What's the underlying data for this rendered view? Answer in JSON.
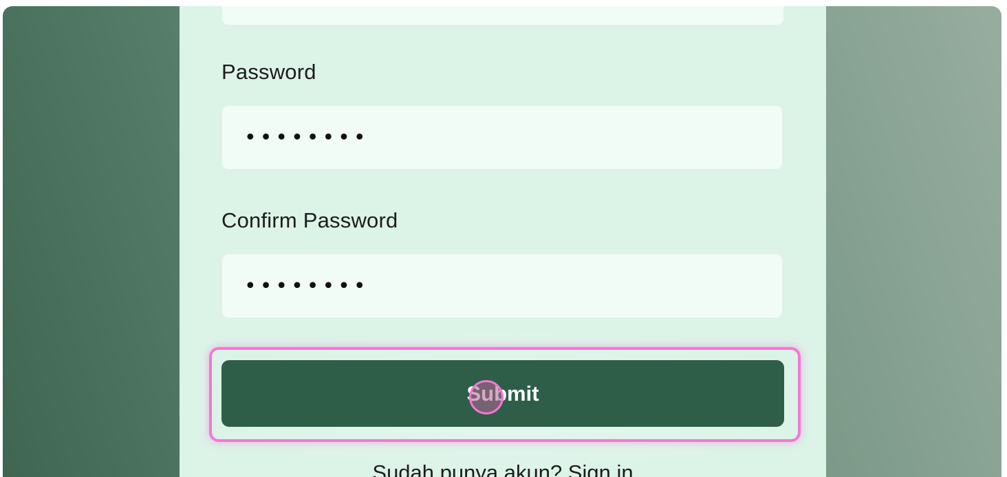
{
  "form": {
    "password_label": "Password",
    "password_value": "••••••••",
    "confirm_label": "Confirm Password",
    "confirm_value": "••••••••",
    "submit_label": "Submit",
    "footer_text": "Sudah punya akun? Sign in"
  },
  "colors": {
    "button": "#2e5e48",
    "panel": "#dcf3e8",
    "highlight": "#f577d6"
  }
}
